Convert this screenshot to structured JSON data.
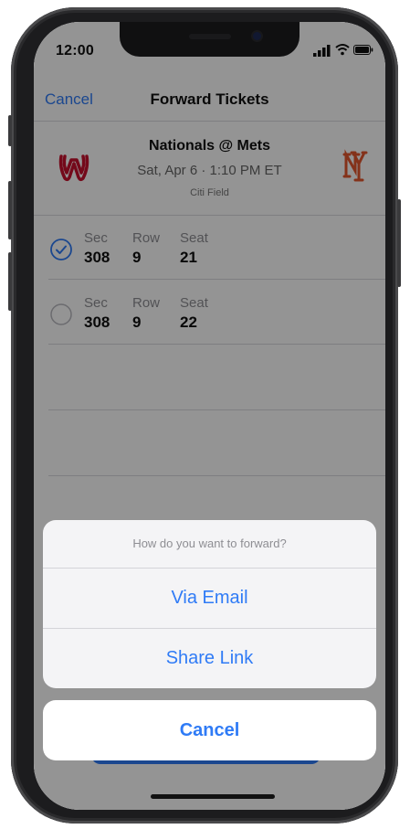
{
  "status_bar": {
    "time": "12:00"
  },
  "nav": {
    "cancel_label": "Cancel",
    "title": "Forward Tickets"
  },
  "event": {
    "matchup": "Nationals @ Mets",
    "datetime": "Sat, Apr 6  ·  1:10 PM ET",
    "venue": "Citi Field",
    "home_logo_icon": "mets-logo-icon",
    "away_logo_icon": "nationals-logo-icon"
  },
  "seats": [
    {
      "selected": true,
      "sec_label": "Sec",
      "sec": "308",
      "row_label": "Row",
      "row": "9",
      "seat_label": "Seat",
      "seat": "21"
    },
    {
      "selected": false,
      "sec_label": "Sec",
      "sec": "308",
      "row_label": "Row",
      "row": "9",
      "seat_label": "Seat",
      "seat": "22"
    }
  ],
  "action_sheet": {
    "title": "How do you want to forward?",
    "options": [
      {
        "label": "Via Email"
      },
      {
        "label": "Share Link"
      }
    ],
    "cancel_label": "Cancel"
  },
  "colors": {
    "accent": "#2f7bf6",
    "nationals_red": "#c8102e",
    "mets_orange": "#e4572e"
  }
}
